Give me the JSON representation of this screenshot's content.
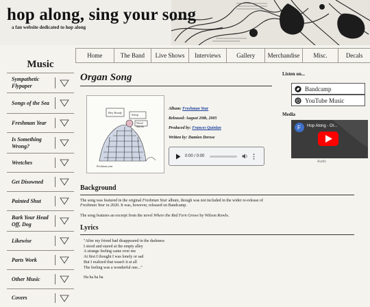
{
  "header": {
    "title": "hop along, sing your song",
    "tagline": "a fan website dedicated to hop along"
  },
  "nav": {
    "items": [
      "Home",
      "The Band",
      "Live Shows",
      "Interviews",
      "Gallery",
      "Merchandise",
      "Misc.",
      "Decals"
    ]
  },
  "sidebar": {
    "heading": "Music",
    "items": [
      "Sympathetic Flypaper",
      "Songs of the Sea",
      "Freshman Year",
      "Is Something Wrong?",
      "Wretches",
      "Get Disowned",
      "Painted Shut",
      "Bark Your Head Off, Dog",
      "Likewise",
      "Parts Work",
      "Other Music",
      "Covers"
    ]
  },
  "song": {
    "title": "Organ Song",
    "album_label": "Album:",
    "album": "Freshman Year",
    "released_label": "Released:",
    "released": "August 20th, 2005",
    "produced_label": "Produced by:",
    "producer": "Frances Quinlan",
    "written_label": "Written by:",
    "writer": "Damien Derose"
  },
  "audio": {
    "time": "0:00 / 0:00"
  },
  "listen": {
    "heading": "Listen on...",
    "bandcamp": "Bandcamp",
    "youtube": "YouTube Music"
  },
  "media": {
    "heading": "Media",
    "video_title": "Hop Along - Or...",
    "video_sub": "Audio"
  },
  "background": {
    "heading": "Background",
    "p1_a": "The song was featured in the original ",
    "p1_em": "Freshman Year",
    "p1_b": " album, though was not included in the wider re-release of ",
    "p1_em2": "Freshman Year",
    "p1_c": " in 2020. It was, however, released on Bandcamp.",
    "p2_a": "The song features an excerpt from the novel ",
    "p2_em": "Where the Red Fern Grows",
    "p2_b": " by Wilson Rowls."
  },
  "lyrics": {
    "heading": "Lyrics",
    "lines": [
      "\"After my friend had disappeared in the darkness",
      "I stood and stared at the empty alley",
      "A strange feeling came over me",
      "At first I thought I was lonely or sad",
      "But I realized that wasn't it at all",
      "The feeling was a wonderful one...\"",
      "",
      "Ha ha ha ha"
    ]
  },
  "cover": {
    "sign1": "Hey Ready",
    "sign2": "Sleep",
    "sign3": "Wood",
    "sign4": "Marlin",
    "caption": "Freshman year"
  }
}
